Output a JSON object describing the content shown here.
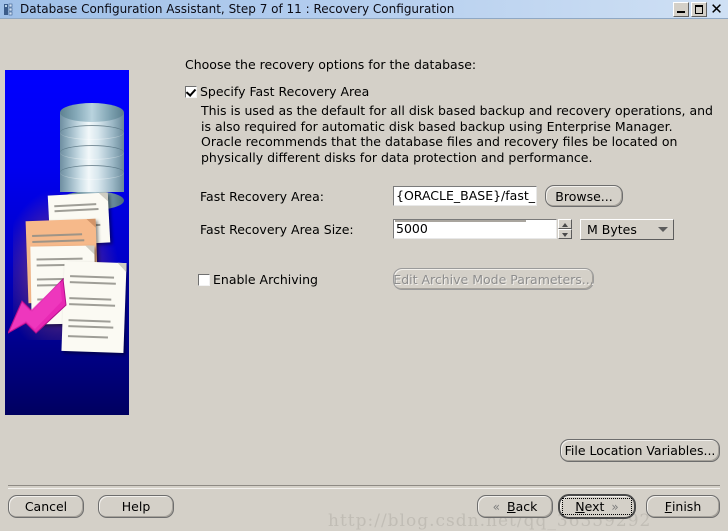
{
  "window": {
    "title": "Database Configuration Assistant, Step 7 of 11 : Recovery Configuration",
    "icon": "app-icon",
    "minimize_label": "–",
    "maximize_label": "□",
    "close_label": "✕"
  },
  "content": {
    "lead": "Choose the recovery options for the database:",
    "specify_fra": {
      "label": "Specify Fast Recovery Area",
      "checked": true
    },
    "description": "This is used as the default for all disk based backup and recovery operations, and is also required for automatic disk based backup using Enterprise Manager. Oracle recommends that the database files and recovery files be located on physically different disks for data protection and performance.",
    "fields": {
      "area_label": "Fast Recovery Area:",
      "area_value": "{ORACLE_BASE}/fast_recovery_a",
      "browse_label": "Browse...",
      "size_label": "Fast Recovery Area Size:",
      "size_value": "5000",
      "units_value": "M Bytes"
    },
    "archiving": {
      "label": "Enable Archiving",
      "checked": false,
      "edit_button_label": "Edit Archive Mode Parameters...",
      "edit_button_enabled": false
    },
    "file_location_variables_label": "File Location Variables..."
  },
  "footer": {
    "cancel_label": "Cancel",
    "help_label": "Help",
    "back_label": "Back",
    "back_mnemonic": "B",
    "next_label": "Next",
    "next_mnemonic": "N",
    "finish_label": "Finish",
    "finish_mnemonic": "F",
    "back_chevron": "«",
    "next_chevron": "»"
  },
  "watermark": "http://blog.csdn.net/qq_36359292",
  "colors": {
    "window_face": "#d4d0c8",
    "titlebar_start": "#9fc0e8",
    "titlebar_end": "#cfe0f4",
    "illustration_top": "#0000ff",
    "illustration_bottom": "#000060",
    "arrow": "#e828b4",
    "sheet_highlight": "#f6b98a"
  }
}
